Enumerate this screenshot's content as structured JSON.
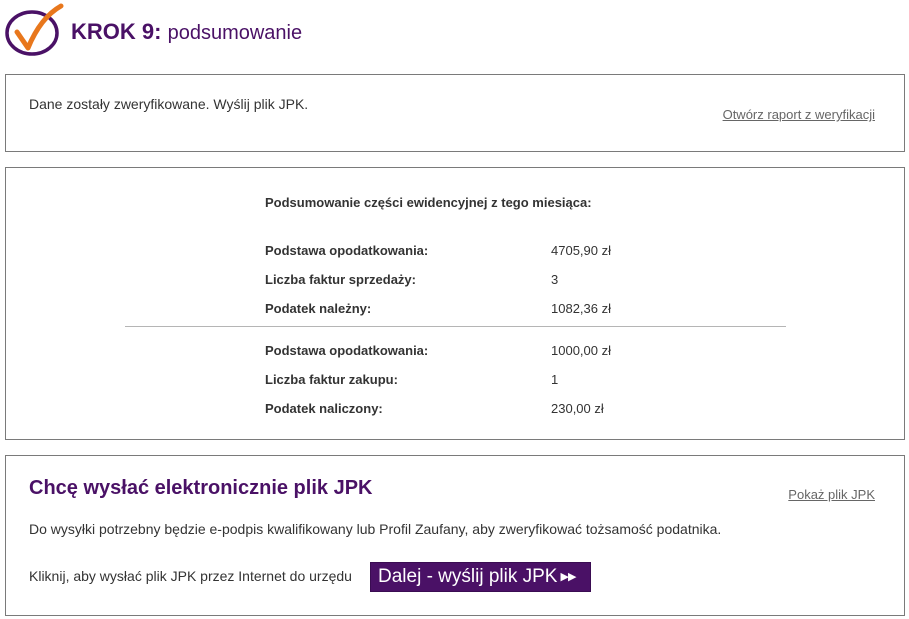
{
  "header": {
    "step_label": "KROK 9:",
    "step_name": "podsumowanie",
    "logo_icon": "checkmark-circle-icon",
    "brand_color": "#4a1166",
    "accent_color": "#e8771c"
  },
  "verification": {
    "message": "Dane zostały zweryfikowane. Wyślij plik JPK.",
    "report_link": "Otwórz raport z weryfikacji"
  },
  "summary": {
    "heading": "Podsumowanie części ewidencyjnej z tego miesiąca:",
    "sales": [
      {
        "label": "Podstawa opodatkowania:",
        "value": "4705,90 zł"
      },
      {
        "label": "Liczba faktur sprzedaży:",
        "value": "3"
      },
      {
        "label": "Podatek należny:",
        "value": "1082,36 zł"
      }
    ],
    "purchases": [
      {
        "label": "Podstawa opodatkowania:",
        "value": "1000,00 zł"
      },
      {
        "label": "Liczba faktur zakupu:",
        "value": "1"
      },
      {
        "label": "Podatek naliczony:",
        "value": "230,00 zł"
      }
    ]
  },
  "send": {
    "heading": "Chcę wysłać elektronicznie plik JPK",
    "show_link": "Pokaż plik JPK",
    "note": "Do wysyłki potrzebny będzie e-podpis kwalifikowany lub Profil Zaufany, aby zweryfikować tożsamość podatnika.",
    "click_text": "Kliknij, aby wysłać plik JPK przez Internet do urzędu",
    "button_label": "Dalej - wyślij plik JPK",
    "button_icon": "double-arrow-right-icon"
  }
}
